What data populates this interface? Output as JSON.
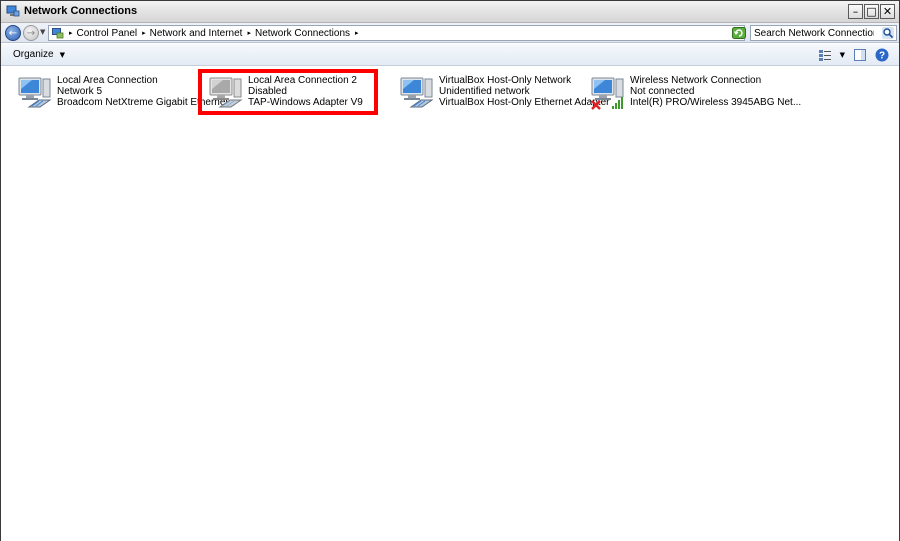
{
  "window": {
    "title": "Network Connections",
    "min_glyph": "–",
    "max_glyph": "□",
    "close_glyph": "✕"
  },
  "nav": {
    "back_glyph": "←",
    "forward_glyph": "→",
    "dropdown_glyph": "▼"
  },
  "address": {
    "breadcrumbs": [
      "Control Panel",
      "Network and Internet",
      "Network Connections"
    ],
    "sep_glyph": "▸",
    "dropdown_glyph": "▼"
  },
  "search": {
    "placeholder": "Search Network Connections"
  },
  "toolbar": {
    "organize_label": "Organize",
    "dropdown_glyph": "▼"
  },
  "connections": [
    {
      "name": "Local Area Connection",
      "status": "Network  5",
      "adapter": "Broadcom NetXtreme Gigabit Ethernet",
      "state": "enabled",
      "kind": "wired"
    },
    {
      "name": "Local Area Connection 2",
      "status": "Disabled",
      "adapter": "TAP-Windows Adapter V9",
      "state": "disabled",
      "kind": "wired"
    },
    {
      "name": "VirtualBox Host-Only Network",
      "status": "Unidentified network",
      "adapter": "VirtualBox Host-Only Ethernet Adapter",
      "state": "enabled",
      "kind": "wired"
    },
    {
      "name": "Wireless Network Connection",
      "status": "Not connected",
      "adapter": "Intel(R) PRO/Wireless 3945ABG Net...",
      "state": "not-connected",
      "kind": "wireless"
    }
  ],
  "colors": {
    "highlight": "#ff0000",
    "monitor_screen": "#3d86d8",
    "disabled_screen": "#a9a9a9"
  }
}
